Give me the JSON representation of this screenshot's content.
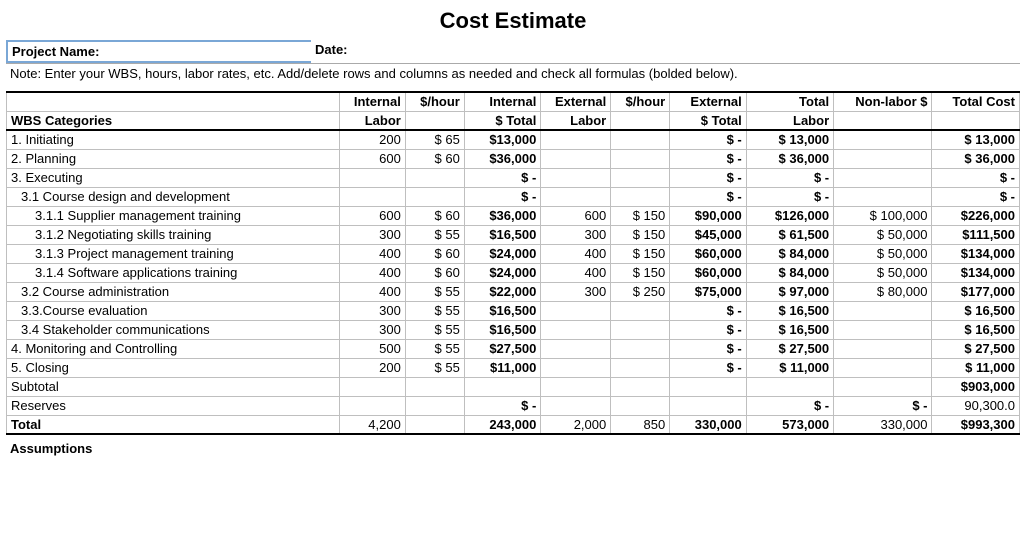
{
  "title": "Cost Estimate",
  "meta": {
    "projectNameLabel": "Project Name:",
    "dateLabel": "Date:"
  },
  "note": "Note: Enter your WBS, hours, labor rates, etc. Add/delete rows and columns as needed and check all formulas (bolded below).",
  "headers": {
    "row1": [
      "",
      "Internal",
      "$/hour",
      "Internal",
      "External",
      "$/hour",
      "External",
      "Total",
      "Non-labor $",
      "Total Cost"
    ],
    "row2": [
      "WBS Categories",
      "Labor",
      "",
      "$ Total",
      "Labor",
      "",
      "$ Total",
      "Labor",
      "",
      ""
    ]
  },
  "rows": [
    {
      "name": "1. Initiating",
      "indent": 0,
      "ilab": "200",
      "irate": "$  65",
      "itot": "$13,000",
      "elab": "",
      "erate": "",
      "etot": "$     -",
      "tlab": "$ 13,000",
      "non": "",
      "tcost": "$  13,000"
    },
    {
      "name": "2. Planning",
      "indent": 0,
      "ilab": "600",
      "irate": "$  60",
      "itot": "$36,000",
      "elab": "",
      "erate": "",
      "etot": "$     -",
      "tlab": "$ 36,000",
      "non": "",
      "tcost": "$  36,000"
    },
    {
      "name": "3. Executing",
      "indent": 0,
      "ilab": "",
      "irate": "",
      "itot": "$      -",
      "elab": "",
      "erate": "",
      "etot": "$     -",
      "tlab": "$       -",
      "non": "",
      "tcost": "$       -"
    },
    {
      "name": "3.1 Course design and development",
      "indent": 1,
      "ilab": "",
      "irate": "",
      "itot": "$      -",
      "elab": "",
      "erate": "",
      "etot": "$     -",
      "tlab": "$       -",
      "non": "",
      "tcost": "$       -"
    },
    {
      "name": "3.1.1 Supplier management training",
      "indent": 2,
      "ilab": "600",
      "irate": "$  60",
      "itot": "$36,000",
      "elab": "600",
      "erate": "$ 150",
      "etot": "$90,000",
      "tlab": "$126,000",
      "non": "$  100,000",
      "tcost": "$226,000"
    },
    {
      "name": "3.1.2 Negotiating skills training",
      "indent": 2,
      "ilab": "300",
      "irate": "$  55",
      "itot": "$16,500",
      "elab": "300",
      "erate": "$ 150",
      "etot": "$45,000",
      "tlab": "$ 61,500",
      "non": "$    50,000",
      "tcost": "$111,500"
    },
    {
      "name": "3.1.3  Project management training",
      "indent": 2,
      "ilab": "400",
      "irate": "$  60",
      "itot": "$24,000",
      "elab": "400",
      "erate": "$ 150",
      "etot": "$60,000",
      "tlab": "$ 84,000",
      "non": "$    50,000",
      "tcost": "$134,000"
    },
    {
      "name": "3.1.4 Software applications training",
      "indent": 2,
      "ilab": "400",
      "irate": "$  60",
      "itot": "$24,000",
      "elab": "400",
      "erate": "$ 150",
      "etot": "$60,000",
      "tlab": "$ 84,000",
      "non": "$    50,000",
      "tcost": "$134,000"
    },
    {
      "name": "3.2 Course administration",
      "indent": 1,
      "ilab": "400",
      "irate": "$  55",
      "itot": "$22,000",
      "elab": "300",
      "erate": "$ 250",
      "etot": "$75,000",
      "tlab": "$ 97,000",
      "non": "$    80,000",
      "tcost": "$177,000"
    },
    {
      "name": "3.3.Course evaluation",
      "indent": 1,
      "ilab": "300",
      "irate": "$  55",
      "itot": "$16,500",
      "elab": "",
      "erate": "",
      "etot": "$     -",
      "tlab": "$ 16,500",
      "non": "",
      "tcost": "$  16,500"
    },
    {
      "name": "3.4 Stakeholder communications",
      "indent": 1,
      "ilab": "300",
      "irate": "$  55",
      "itot": "$16,500",
      "elab": "",
      "erate": "",
      "etot": "$     -",
      "tlab": "$ 16,500",
      "non": "",
      "tcost": "$  16,500"
    },
    {
      "name": "4. Monitoring and Controlling",
      "indent": 0,
      "ilab": "500",
      "irate": "$  55",
      "itot": "$27,500",
      "elab": "",
      "erate": "",
      "etot": "$     -",
      "tlab": "$ 27,500",
      "non": "",
      "tcost": "$  27,500"
    },
    {
      "name": "5. Closing",
      "indent": 0,
      "ilab": "200",
      "irate": "$  55",
      "itot": "$11,000",
      "elab": "",
      "erate": "",
      "etot": "$     -",
      "tlab": "$ 11,000",
      "non": "",
      "tcost": "$  11,000"
    }
  ],
  "subtotal": {
    "name": "Subtotal",
    "tcost": "$903,000"
  },
  "reserves": {
    "name": "Reserves",
    "itot": "$      -",
    "tlab": "$       -",
    "non": "$       -",
    "tcost": "90,300.0"
  },
  "total": {
    "name": "Total",
    "ilab": "4,200",
    "itot": "243,000",
    "elab": "2,000",
    "erate": "850",
    "etot": "330,000",
    "tlab": "573,000",
    "non": "330,000",
    "tcost": "$993,300"
  },
  "assumptionsLabel": "Assumptions"
}
